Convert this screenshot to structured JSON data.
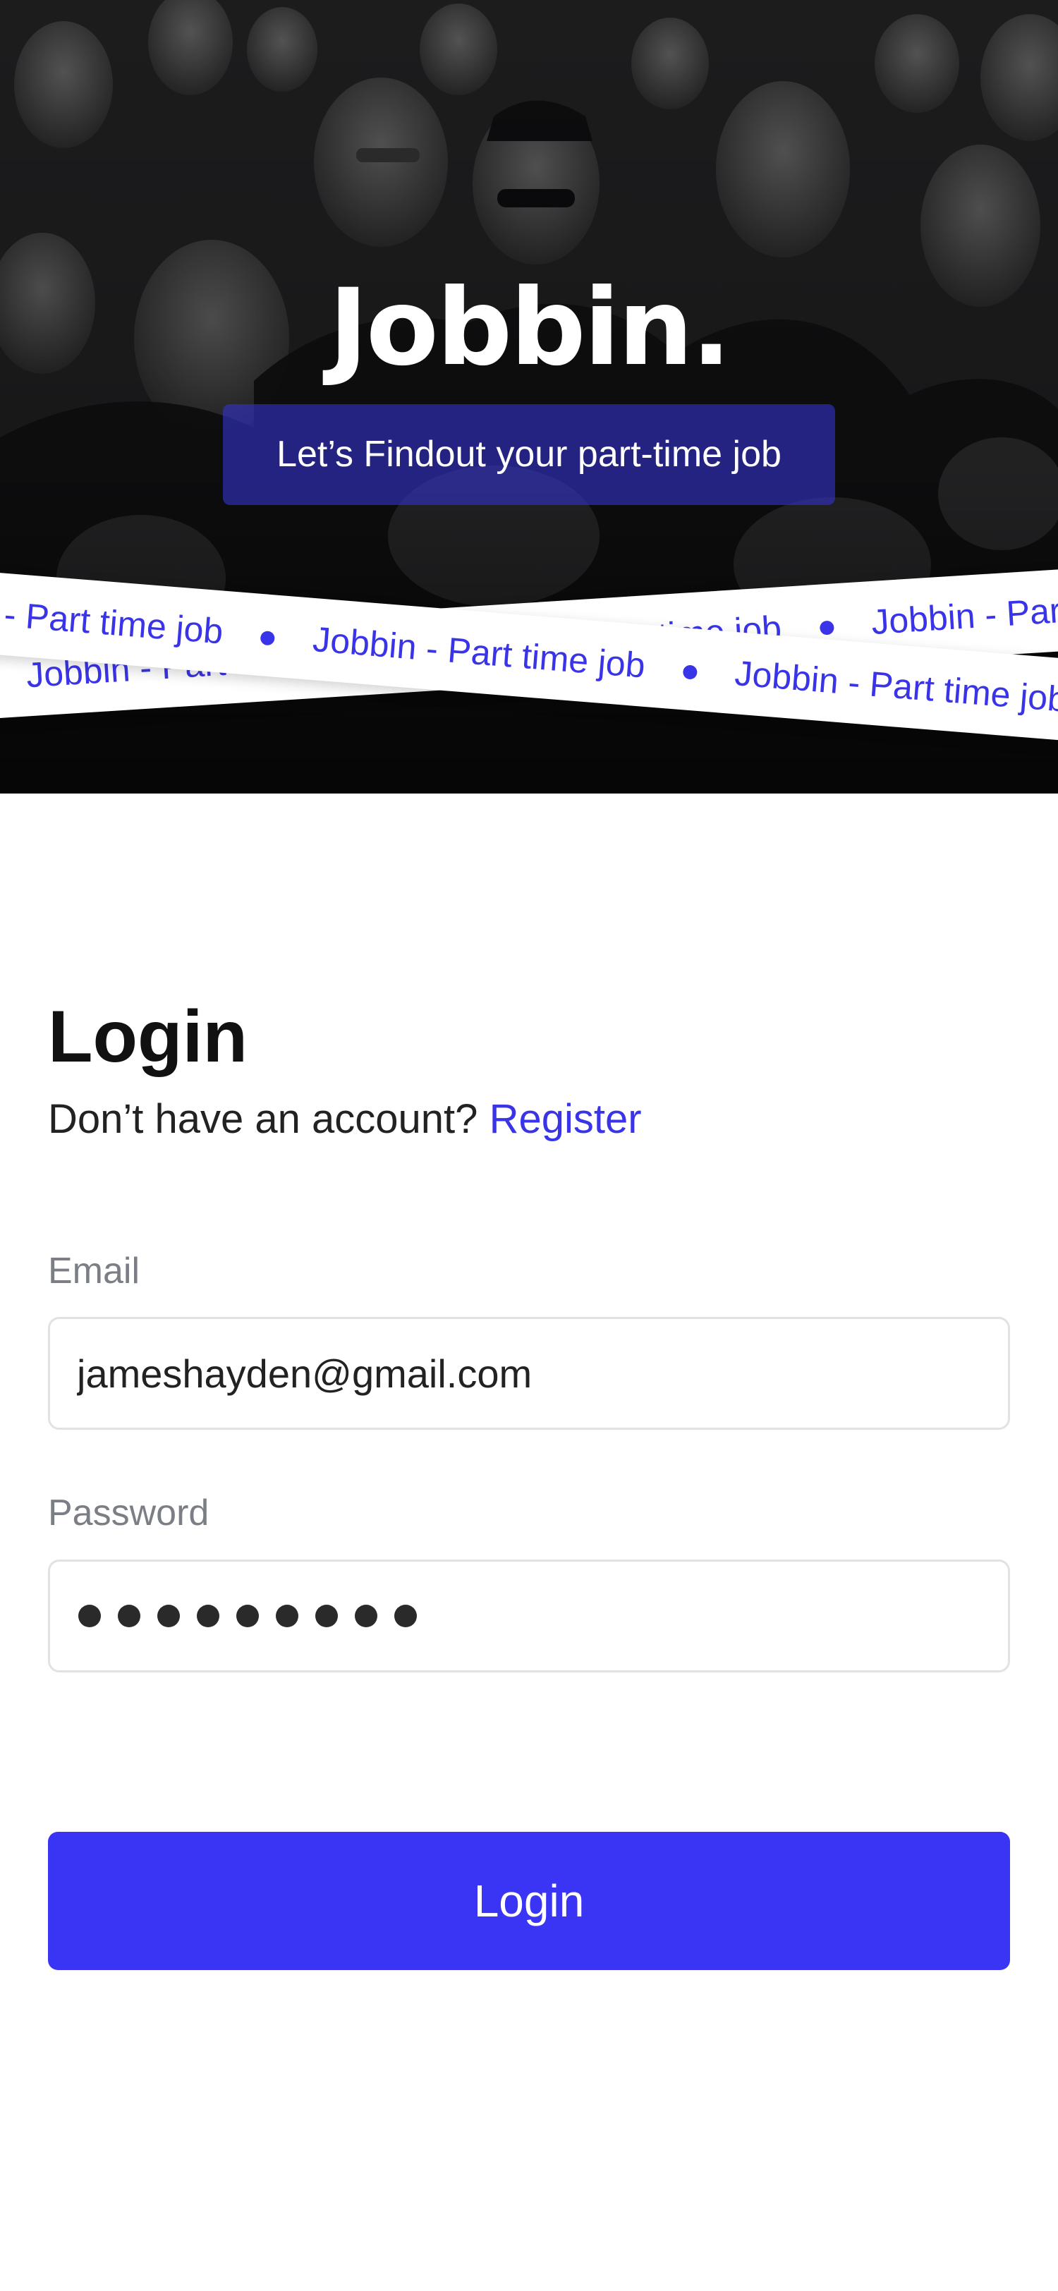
{
  "hero": {
    "brand": "Jobbin.",
    "tagline": "Let’s Findout your part-time job",
    "ribbon_text": "Jobbin - Part time job"
  },
  "login": {
    "title": "Login",
    "no_account_text": "Don’t have an account?",
    "register_label": "Register",
    "email_label": "Email",
    "email_value": "jameshayden@gmail.com",
    "password_label": "Password",
    "password_masked_length": 9,
    "submit_label": "Login"
  },
  "colors": {
    "accent": "#3a34f5",
    "text_primary": "#111111",
    "label_gray": "#7b7f85",
    "input_border": "#e2e2e4"
  }
}
